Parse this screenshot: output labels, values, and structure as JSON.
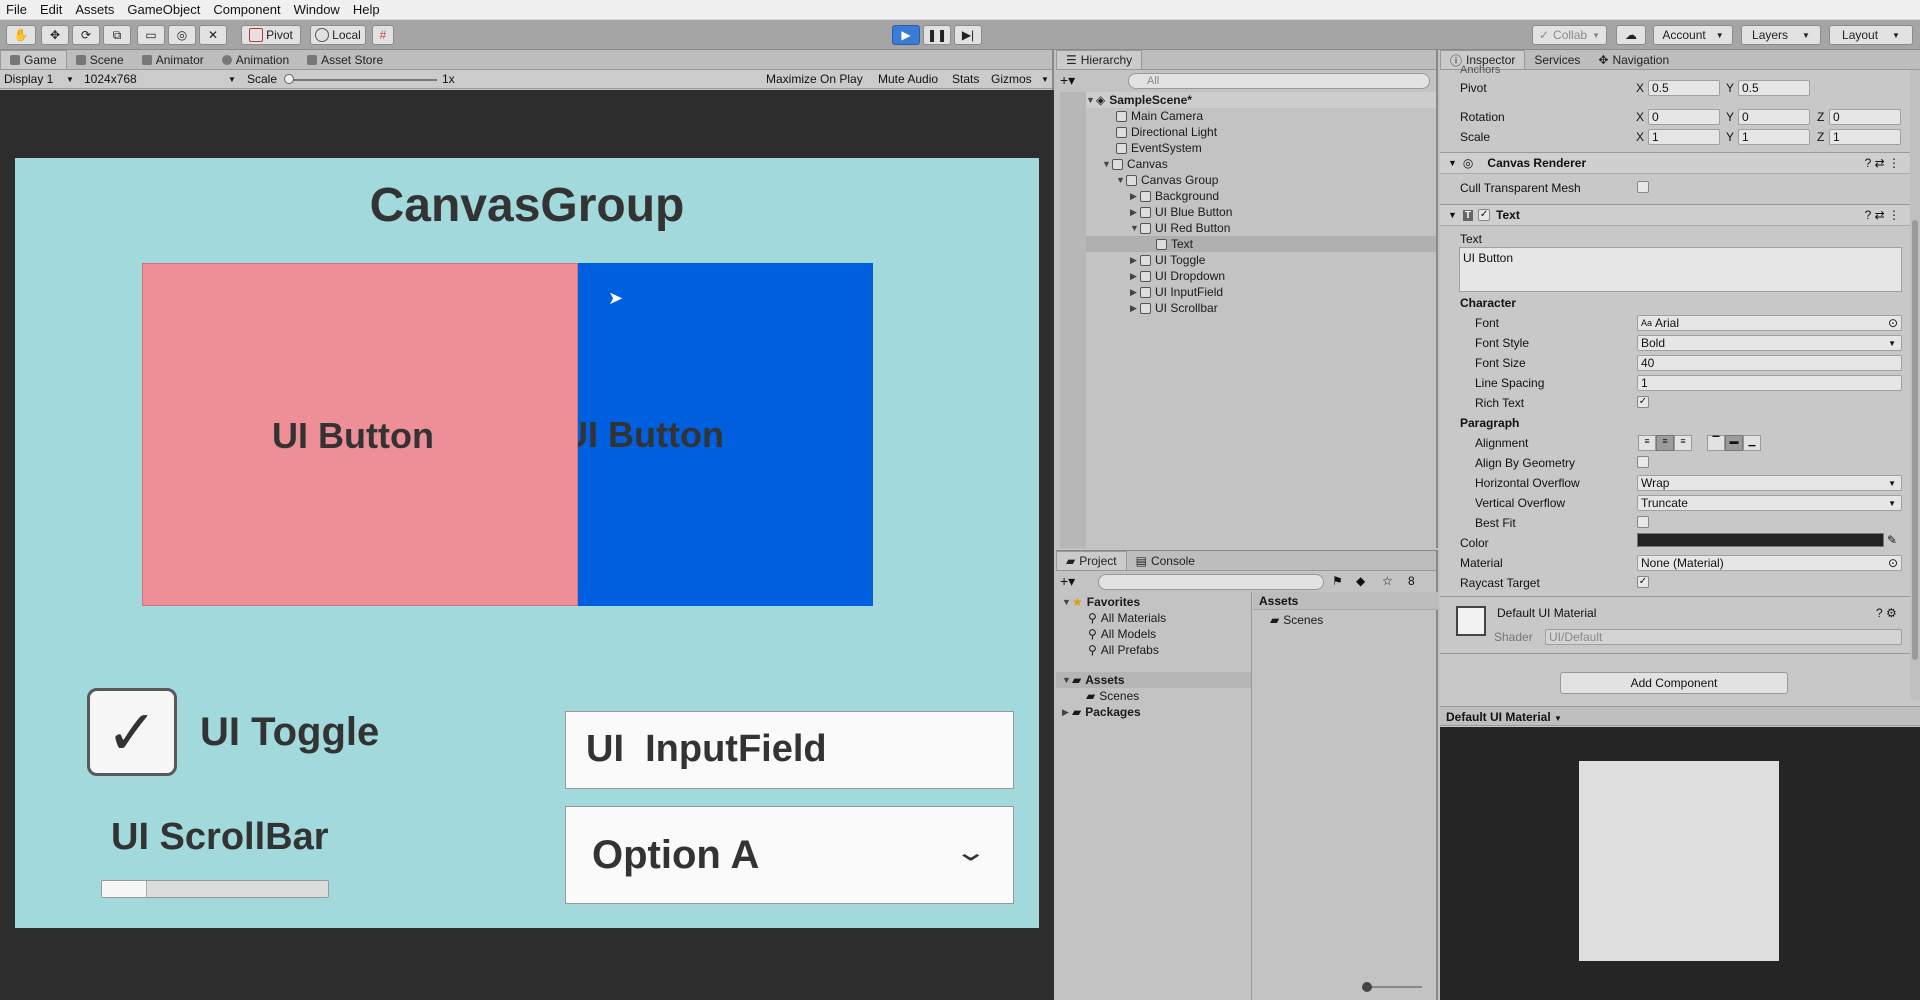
{
  "menu": [
    "File",
    "Edit",
    "Assets",
    "GameObject",
    "Component",
    "Window",
    "Help"
  ],
  "toolbar": {
    "pivot": "Pivot",
    "local": "Local",
    "collab": "Collab",
    "account": "Account",
    "layers": "Layers",
    "layout": "Layout"
  },
  "game_tabs": [
    "Game",
    "Scene",
    "Animator",
    "Animation",
    "Asset Store"
  ],
  "game_ctrl": {
    "display": "Display 1",
    "resolution": "1024x768",
    "scale_label": "Scale",
    "scale_value": "1x",
    "maximize": "Maximize On Play",
    "mute": "Mute Audio",
    "stats": "Stats",
    "gizmos": "Gizmos"
  },
  "game": {
    "title": "CanvasGroup",
    "red_button": "UI Button",
    "blue_button": "UI Button",
    "toggle": "UI Toggle",
    "scrollbar": "UI ScrollBar",
    "inputfield": "UI  InputField",
    "dropdown": "Option A",
    "scrollbar_fill": 0.2,
    "colors": {
      "canvas": "#a1d9dc",
      "red": "#ee8f98",
      "blue": "#005fdf"
    }
  },
  "hierarchy": {
    "tab": "Hierarchy",
    "search_placeholder": "All",
    "scene": "SampleScene*",
    "items": [
      {
        "label": "Main Camera"
      },
      {
        "label": "Directional Light"
      },
      {
        "label": "EventSystem"
      },
      {
        "label": "Canvas"
      },
      {
        "label": "Canvas Group"
      },
      {
        "label": "Background"
      },
      {
        "label": "UI Blue Button"
      },
      {
        "label": "UI Red Button"
      },
      {
        "label": "Text"
      },
      {
        "label": "UI Toggle"
      },
      {
        "label": "UI Dropdown"
      },
      {
        "label": "UI InputField"
      },
      {
        "label": "UI Scrollbar"
      }
    ]
  },
  "project": {
    "tabs": [
      "Project",
      "Console"
    ],
    "count": "8",
    "favorites": "Favorites",
    "fav_items": [
      "All Materials",
      "All Models",
      "All Prefabs"
    ],
    "assets": "Assets",
    "assets_child": "Scenes",
    "packages": "Packages",
    "right_header": "Assets",
    "right_item": "Scenes"
  },
  "inspector": {
    "tabs": [
      "Inspector",
      "Services",
      "Navigation"
    ],
    "anchors": "Anchors",
    "pivot": {
      "label": "Pivot",
      "x": "0.5",
      "y": "0.5"
    },
    "rotation": {
      "label": "Rotation",
      "x": "0",
      "y": "0",
      "z": "0"
    },
    "scale": {
      "label": "Scale",
      "x": "1",
      "y": "1",
      "z": "1"
    },
    "canvas_renderer": "Canvas Renderer",
    "cull": "Cull Transparent Mesh",
    "text_comp": "Text",
    "text_label": "Text",
    "text_value": "UI Button",
    "character": "Character",
    "font": {
      "label": "Font",
      "value": "Arial"
    },
    "font_style": {
      "label": "Font Style",
      "value": "Bold"
    },
    "font_size": {
      "label": "Font Size",
      "value": "40"
    },
    "line_spacing": {
      "label": "Line Spacing",
      "value": "1"
    },
    "rich_text": "Rich Text",
    "paragraph": "Paragraph",
    "alignment": "Alignment",
    "align_geom": "Align By Geometry",
    "h_overflow": {
      "label": "Horizontal Overflow",
      "value": "Wrap"
    },
    "v_overflow": {
      "label": "Vertical Overflow",
      "value": "Truncate"
    },
    "best_fit": "Best Fit",
    "color": "Color",
    "material": {
      "label": "Material",
      "value": "None (Material)"
    },
    "raycast": "Raycast Target",
    "default_mat": "Default UI Material",
    "shader": {
      "label": "Shader",
      "value": "UI/Default"
    },
    "add_component": "Add Component",
    "preview_title": "Default UI Material"
  }
}
